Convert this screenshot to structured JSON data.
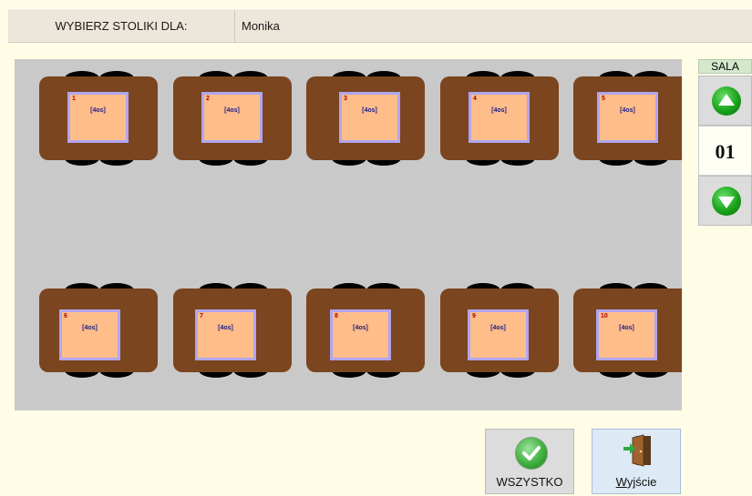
{
  "header": {
    "label": "WYBIERZ STOLIKI DLA:",
    "name": "Monika"
  },
  "tables": [
    {
      "number": "1",
      "seats": "[4os]"
    },
    {
      "number": "2",
      "seats": "[4os]"
    },
    {
      "number": "3",
      "seats": "[4os]"
    },
    {
      "number": "4",
      "seats": "[4os]"
    },
    {
      "number": "5",
      "seats": "[4os]"
    },
    {
      "number": "6",
      "seats": "[4os]"
    },
    {
      "number": "7",
      "seats": "[4os]"
    },
    {
      "number": "8",
      "seats": "[4os]"
    },
    {
      "number": "9",
      "seats": "[4os]"
    },
    {
      "number": "10",
      "seats": "[4os]"
    }
  ],
  "sala": {
    "label": "SALA",
    "number": "01",
    "up_icon": "arrow-up-icon",
    "down_icon": "arrow-down-icon"
  },
  "buttons": {
    "all_label": "WSZYSTKO",
    "all_icon": "check-icon",
    "exit_label": "Wyjście",
    "exit_icon": "door-exit-icon"
  },
  "colors": {
    "background": "#fffde6",
    "floor": "#c9c9c9",
    "table_top": "#7a451f",
    "tablecloth": "#ffbd89",
    "tablecloth_border": "#b0a6f0",
    "chair": "#000000",
    "table_number": "#b00000",
    "seats_text": "#1c1c8c",
    "arrow_button": "#1aa31a"
  }
}
